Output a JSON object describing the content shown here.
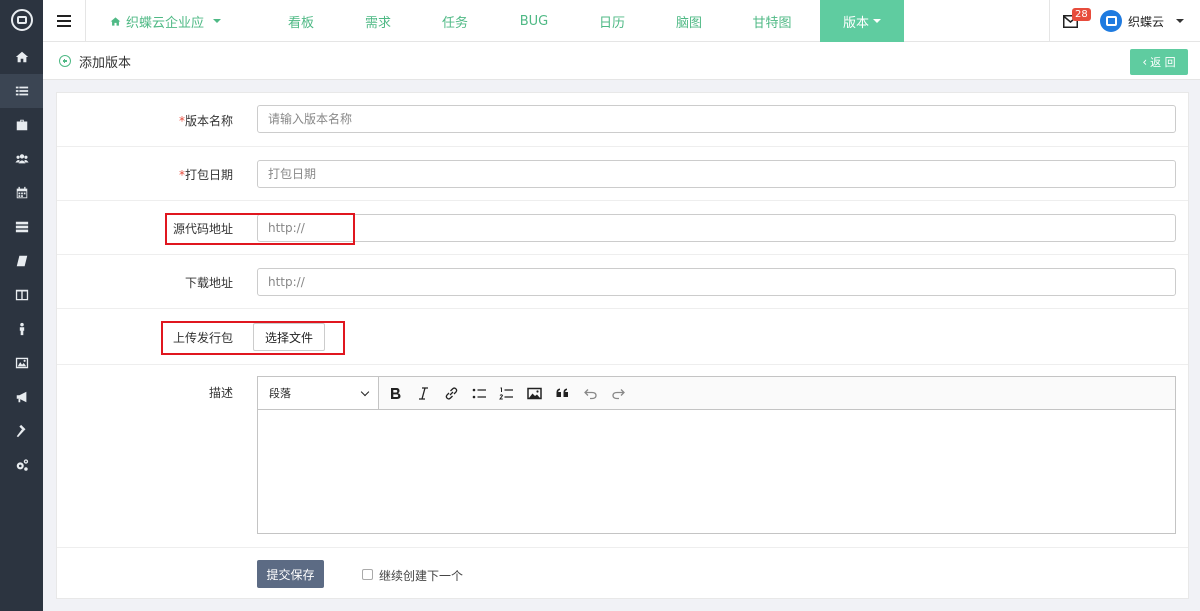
{
  "topnav": {
    "project": "织蝶云企业应",
    "tabs": [
      "看板",
      "需求",
      "任务",
      "BUG",
      "日历",
      "脑图",
      "甘特图",
      "版本"
    ],
    "active_tab": "版本",
    "message_count": "28",
    "user_name": "织蝶云"
  },
  "sidebar": {
    "icons": [
      "home-icon",
      "list-icon",
      "briefcase-icon",
      "users-icon",
      "calendar-icon",
      "server-icon",
      "book-icon",
      "columns-icon",
      "person-icon",
      "image-icon",
      "megaphone-icon",
      "gavel-icon",
      "cogs-icon"
    ],
    "active_index": 1
  },
  "page": {
    "title": "添加版本",
    "back_label": "返 回"
  },
  "form": {
    "version_name": {
      "required_mark": "*",
      "label": "版本名称",
      "placeholder": "请输入版本名称"
    },
    "build_date": {
      "required_mark": "*",
      "label": "打包日期",
      "placeholder": "打包日期"
    },
    "source_url": {
      "label": "源代码地址",
      "placeholder": "http://"
    },
    "download_url": {
      "label": "下载地址",
      "placeholder": "http://"
    },
    "upload": {
      "label": "上传发行包",
      "button": "选择文件"
    },
    "description": {
      "label": "描述",
      "format_value": "段落"
    },
    "submit": "提交保存",
    "continue_label": "继续创建下一个"
  },
  "colors": {
    "accent": "#5fcca0",
    "sidebar": "#2c3440",
    "submit": "#5c6b84",
    "highlight": "#e0161f"
  }
}
